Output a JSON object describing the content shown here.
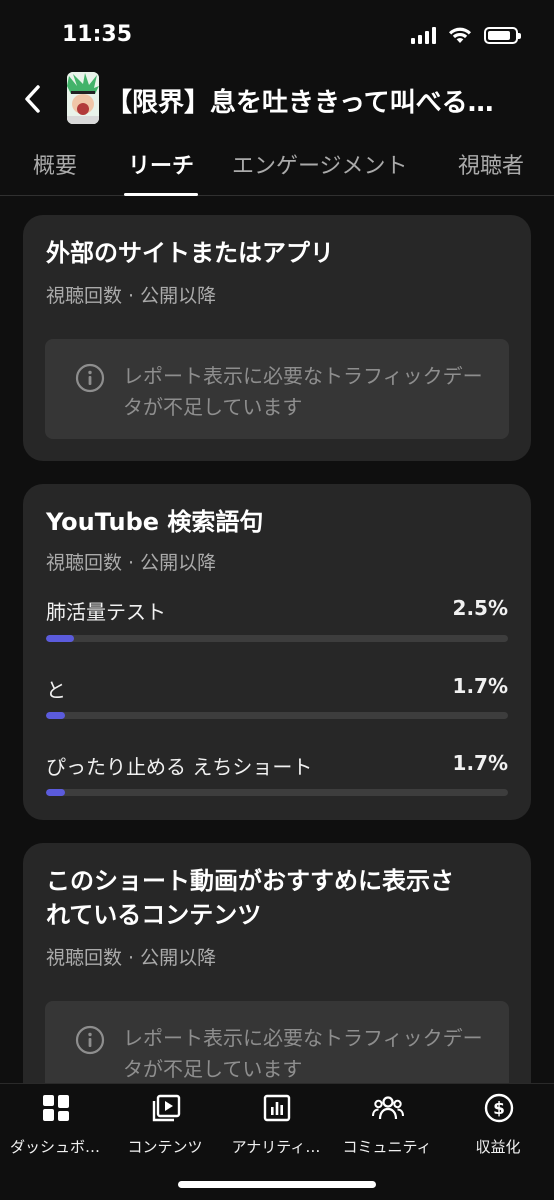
{
  "status_bar": {
    "time": "11:35",
    "battery_level": 0.85
  },
  "header": {
    "title": "【限界】息を吐ききって叫べる…",
    "back_icon": "chevron-left-icon"
  },
  "tabs": [
    {
      "label": "概要"
    },
    {
      "label": "リーチ",
      "active": true
    },
    {
      "label": "エンゲージメント"
    },
    {
      "label": "視聴者"
    }
  ],
  "cards": {
    "external": {
      "title": "外部のサイトまたはアプリ",
      "subtitle": "視聴回数 · 公開以降",
      "notice": "レポート表示に必要なトラフィックデータが不足しています"
    },
    "search": {
      "title": "YouTube 検索語句",
      "subtitle": "視聴回数 · 公開以降",
      "rows": [
        {
          "label": "肺活量テスト",
          "value": "2.5%",
          "fraction": 0.025
        },
        {
          "label": "と",
          "value": "1.7%",
          "fraction": 0.017
        },
        {
          "label": "ぴったり止める えちショート",
          "value": "1.7%",
          "fraction": 0.017
        }
      ]
    },
    "suggested": {
      "title_line1": "このショート動画がおすすめに表示さ",
      "title_line2": "れているコンテンツ",
      "subtitle": "視聴回数 · 公開以降",
      "notice": "レポート表示に必要なトラフィックデータが不足しています"
    }
  },
  "bottom_nav": [
    {
      "label": "ダッシュボ…",
      "icon": "dashboard-icon"
    },
    {
      "label": "コンテンツ",
      "icon": "content-icon"
    },
    {
      "label": "アナリティ…",
      "icon": "analytics-icon"
    },
    {
      "label": "コミュニティ",
      "icon": "community-icon"
    },
    {
      "label": "収益化",
      "icon": "monetization-icon"
    }
  ],
  "colors": {
    "accent_bar": "#5b5bdc",
    "card_bg": "#272727",
    "page_bg": "#0f0f0f"
  }
}
